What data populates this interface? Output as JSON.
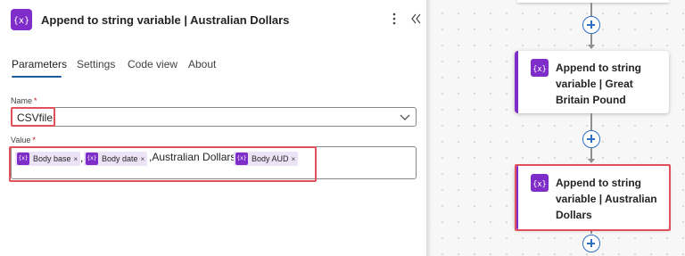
{
  "panel": {
    "title": "Append to string variable | Australian Dollars",
    "icon": "variable-icon",
    "tabs": [
      {
        "label": "Parameters",
        "active": true
      },
      {
        "label": "Settings",
        "active": false
      },
      {
        "label": "Code view",
        "active": false
      },
      {
        "label": "About",
        "active": false
      }
    ],
    "name_field": {
      "label": "Name",
      "required_mark": "*",
      "value": "CSVfile"
    },
    "value_field": {
      "label": "Value",
      "required_mark": "*",
      "tokens": [
        {
          "label": "Body base",
          "remove": "×"
        },
        {
          "label": "Body date",
          "remove": "×"
        },
        {
          "label": "Body AUD",
          "remove": "×"
        }
      ],
      "separators": [
        ",",
        ",Australian Dollars,"
      ],
      "token_icon_text": "{x}"
    }
  },
  "canvas": {
    "cards": [
      {
        "title": "Append to string variable | Great Britain Pound",
        "icon": "variable-icon"
      },
      {
        "title": "Append to string variable | Australian Dollars",
        "icon": "variable-icon",
        "highlighted": true
      }
    ]
  },
  "colors": {
    "accent_purple": "#7e2dc9",
    "add_button_blue": "#2f6fc1",
    "highlight_red": "#e1505b",
    "tab_underline": "#1f5a9a"
  }
}
